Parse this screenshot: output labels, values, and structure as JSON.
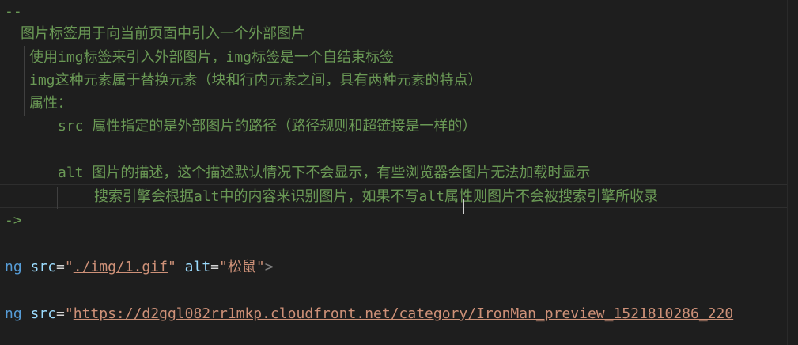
{
  "editor": {
    "comment_open_fragment": "--",
    "comment_lines": [
      "图片标签用于向当前页面中引入一个外部图片",
      "使用img标签来引入外部图片，img标签是一个自结束标签",
      "img这种元素属于替换元素（块和行内元素之间，具有两种元素的特点）",
      "属性：",
      "src 属性指定的是外部图片的路径（路径规则和超链接是一样的）",
      "alt 图片的描述，这个描述默认情况下不会显示，有些浏览器会图片无法加载时显示",
      "搜索引擎会根据alt中的内容来识别图片，如果不写alt属性则图片不会被搜索引擎所收录"
    ],
    "comment_close_fragment": "->",
    "code_lines": [
      {
        "tag_fragment": "ng",
        "attr1": "src",
        "eq1": "=",
        "quote": "\"",
        "value1": "./img/1.gif",
        "attr2": "alt",
        "eq2": "=",
        "value2": "\"松鼠\"",
        "end": ">"
      },
      {
        "tag_fragment": "ng",
        "attr1": "src",
        "eq1": "=",
        "quote": "\"",
        "value1": "https://d2ggl082rr1mkp.cloudfront.net/category/IronMan_preview_1521810286_220"
      }
    ]
  },
  "colors": {
    "background": "#1e1e1e",
    "comment": "#6a9955",
    "tag": "#569cd6",
    "attribute": "#9cdcfe",
    "string": "#ce9178"
  }
}
